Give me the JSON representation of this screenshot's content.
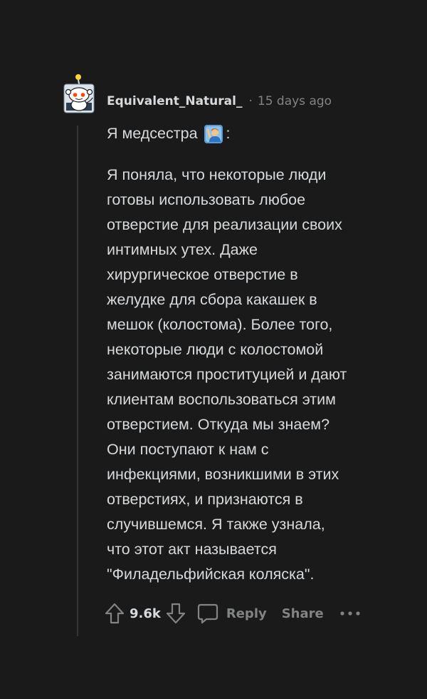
{
  "comment": {
    "username": "Equivalent_Natural_",
    "separator": "·",
    "time": "15 days ago",
    "intro_text": "Я медсестра",
    "intro_suffix": ":",
    "intro_emoji": "person-raising-hand-emoji",
    "body_text": "Я поняла, что некоторые люди\nготовы использовать любое\nотверстие для реализации своих\nинтимных утех. Даже\nхирургическое отверстие в\nжелудке для сбора какашек в\nмешок (колостома). Более того,\nнекоторые люди с колостомой\nзанимаются проституцией и дают\nклиентам воспользоваться этим\nотверстием. Откуда мы знаем?\nОни поступают к нам с\nинфекциями, возникшими в этих\nотверстиях, и признаются в\nслучившемся. Я также узнала,\nчто этот акт называется\n\"Филадельфийская коляска\"."
  },
  "actions": {
    "upvote_icon": "upvote-arrow-icon",
    "vote_count": "9.6k",
    "downvote_icon": "downvote-arrow-icon",
    "reply_icon": "comment-bubble-icon",
    "reply_label": "Reply",
    "share_label": "Share",
    "more_icon": "more-dots-icon"
  },
  "colors": {
    "background": "#1a1a1b",
    "text": "#d7dadc",
    "muted": "#818384",
    "thread_line": "#343536"
  }
}
